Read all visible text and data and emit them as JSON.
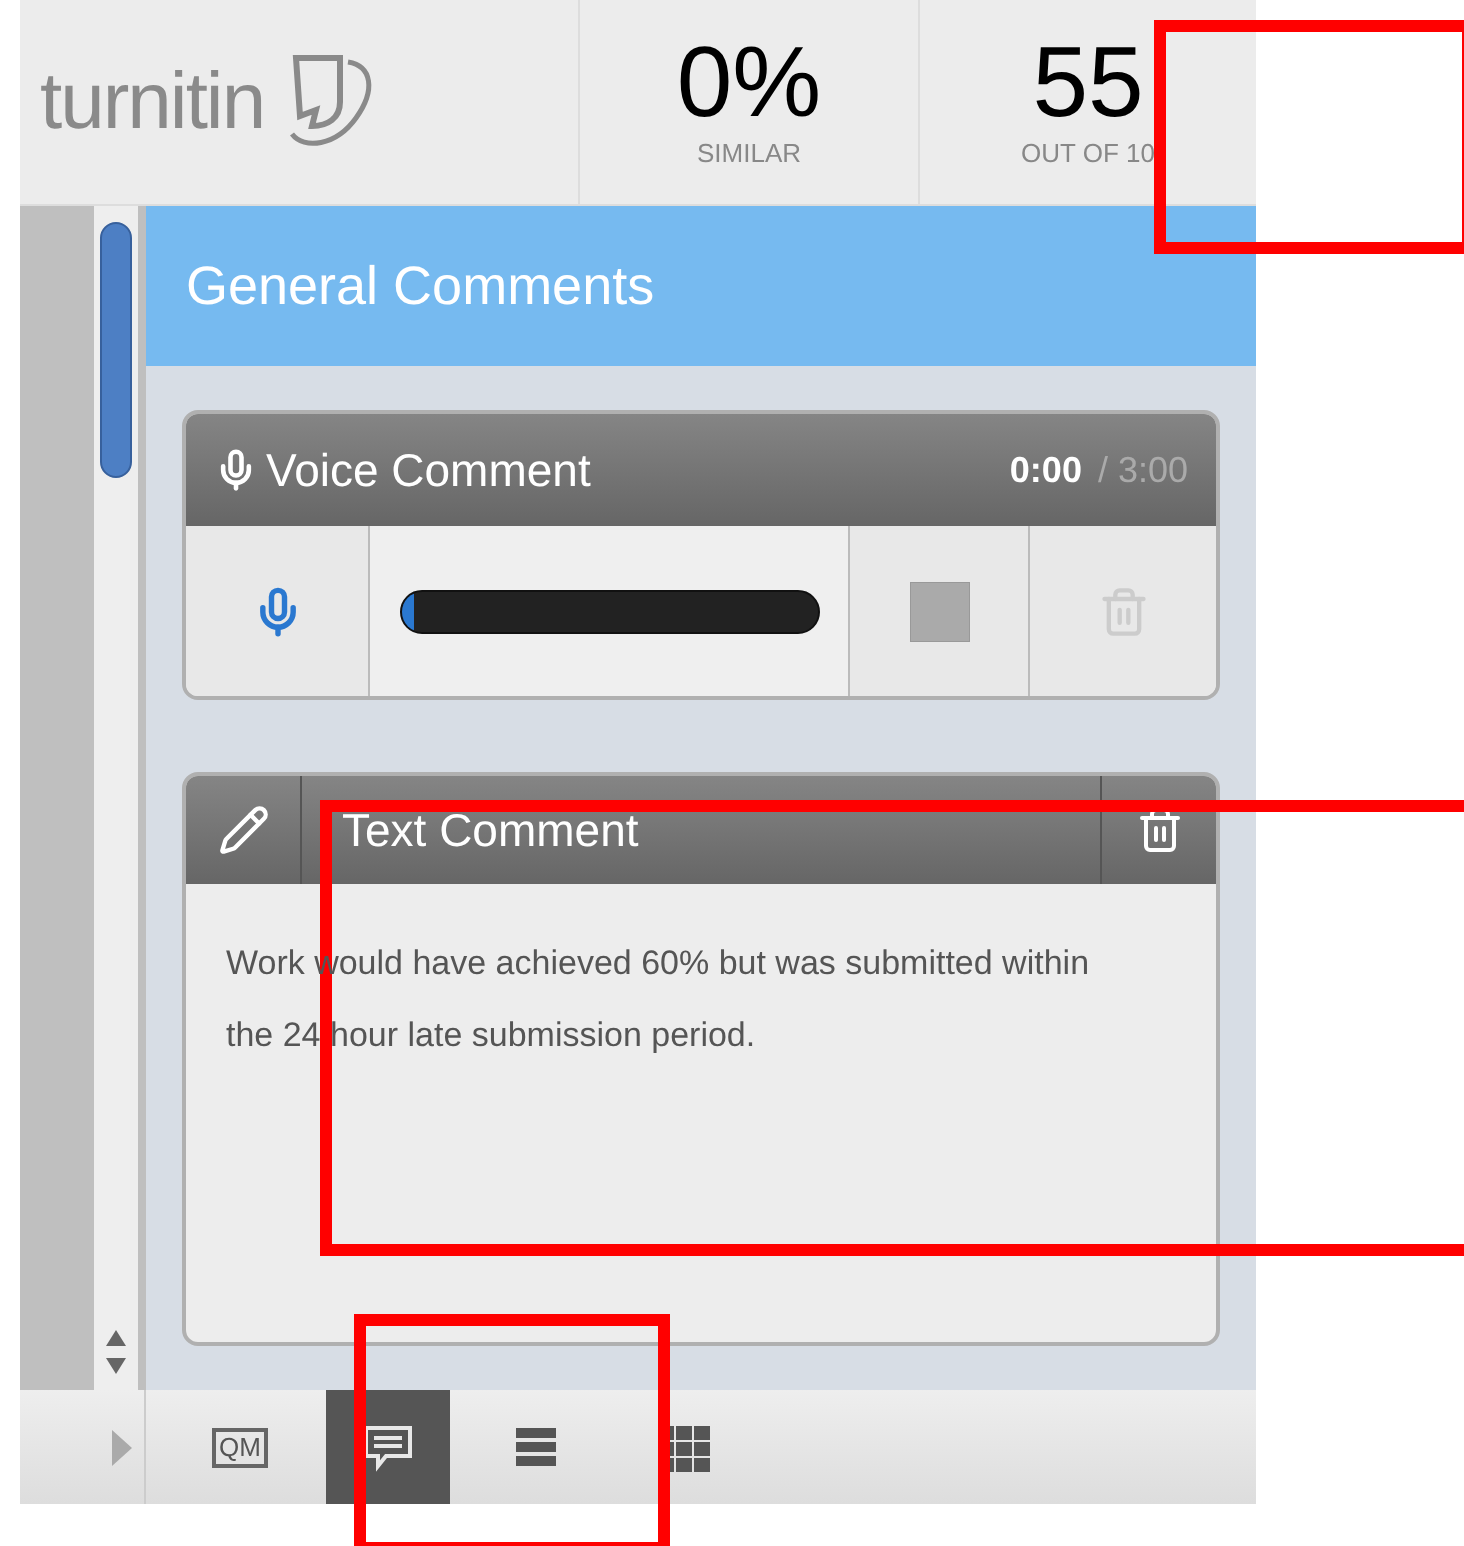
{
  "header": {
    "logo_text": "turnitin",
    "similarity": {
      "value": "0%",
      "label": "SIMILAR"
    },
    "grade": {
      "value": "55",
      "label": "OUT OF 10"
    }
  },
  "panel": {
    "title": "General Comments",
    "voice_comment": {
      "title": "Voice Comment",
      "elapsed": "0:00",
      "duration": "/ 3:00",
      "level": 0
    },
    "text_comment": {
      "title": "Text Comment",
      "body": "Work would have achieved 60% but was submitted within the 24 hour late submission period."
    }
  },
  "toolbar": [
    {
      "kind": "qm",
      "label": "QM",
      "selected": false
    },
    {
      "kind": "comments",
      "selected": true
    },
    {
      "kind": "list",
      "selected": false
    },
    {
      "kind": "grid",
      "selected": false
    }
  ],
  "annotation_boxes": [
    {
      "kind": "rectangle"
    },
    {
      "kind": "rectangle"
    },
    {
      "kind": "rectangle"
    }
  ]
}
